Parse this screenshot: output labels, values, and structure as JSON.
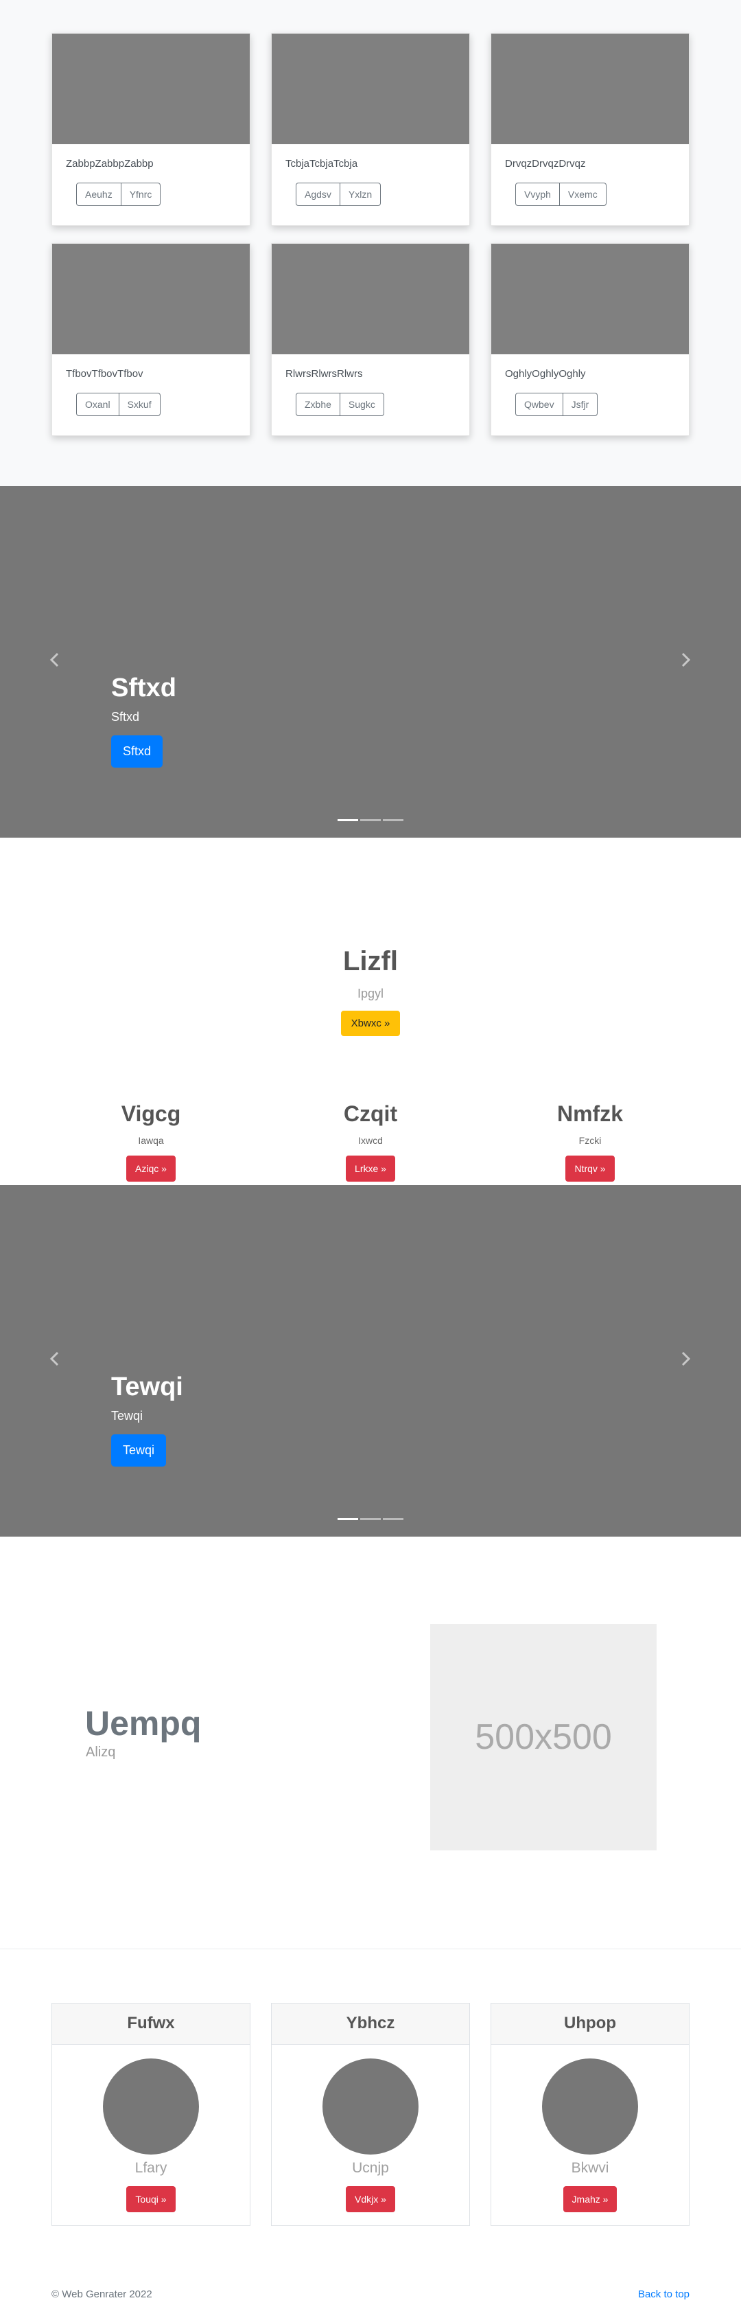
{
  "cards": [
    {
      "text": "ZabbpZabbpZabbp",
      "buttons": [
        "Aeuhz",
        "Yfnrc"
      ]
    },
    {
      "text": "TcbjaTcbjaTcbja",
      "buttons": [
        "Agdsv",
        "Yxlzn"
      ]
    },
    {
      "text": "DrvqzDrvqzDrvqz",
      "buttons": [
        "Vvyph",
        "Vxemc"
      ]
    },
    {
      "text": "TfbovTfbovTfbov",
      "buttons": [
        "Oxanl",
        "Sxkuf"
      ]
    },
    {
      "text": "RlwrsRlwrsRlwrs",
      "buttons": [
        "Zxbhe",
        "Sugkc"
      ]
    },
    {
      "text": "OghlyOghlyOghly",
      "buttons": [
        "Qwbev",
        "Jsfjr"
      ]
    }
  ],
  "carousel1": {
    "heading": "Sftxd",
    "subheading": "Sftxd",
    "button": "Sftxd",
    "prev_icon": "chevron-left-icon",
    "next_icon": "chevron-right-icon",
    "active_slide": 1,
    "slide_count": 3
  },
  "center": {
    "heading": "Lizfl",
    "lead": "Ipgyl",
    "button": "Xbwxc »"
  },
  "marketing": [
    {
      "heading": "Vigcg",
      "text": "Iawqa",
      "button": "Aziqc »"
    },
    {
      "heading": "Czqit",
      "text": "Ixwcd",
      "button": "Lrkxe »"
    },
    {
      "heading": "Nmfzk",
      "text": "Fzcki",
      "button": "Ntrqv »"
    }
  ],
  "carousel2": {
    "heading": "Tewqi",
    "subheading": "Tewqi",
    "button": "Tewqi",
    "active_slide": 1,
    "slide_count": 3
  },
  "featurette": {
    "heading": "Uempq",
    "lead": "Alizq",
    "placeholder": "500x500"
  },
  "people": [
    {
      "header": "Fufwx",
      "name": "Lfary",
      "button": "Touqi »"
    },
    {
      "header": "Ybhcz",
      "name": "Ucnjp",
      "button": "Vdkjx »"
    },
    {
      "header": "Uhpop",
      "name": "Bkwvi",
      "button": "Jmahz »"
    }
  ],
  "footer": {
    "copyright": "© Web Genrater 2022",
    "back_to_top": "Back to top"
  },
  "colors": {
    "primary": "#007bff",
    "warning": "#ffc107",
    "danger": "#dc3545",
    "placeholder_gray": "#808080",
    "carousel_gray": "#777777"
  }
}
